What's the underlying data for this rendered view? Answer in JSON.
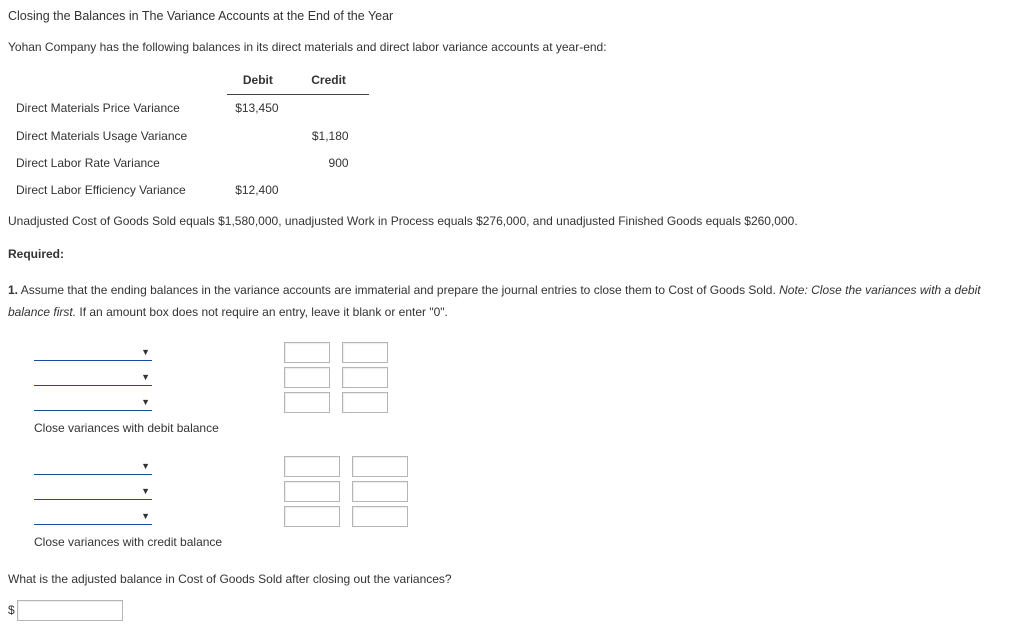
{
  "title": "Closing the Balances in The Variance Accounts at the End of the Year",
  "intro": "Yohan Company has the following balances in its direct materials and direct labor variance accounts at year-end:",
  "table": {
    "headers": {
      "debit": "Debit",
      "credit": "Credit"
    },
    "rows": [
      {
        "label": "Direct Materials Price Variance",
        "debit": "$13,450",
        "credit": ""
      },
      {
        "label": "Direct Materials Usage Variance",
        "debit": "",
        "credit": "$1,180"
      },
      {
        "label": "Direct Labor Rate Variance",
        "debit": "",
        "credit": "900"
      },
      {
        "label": "Direct Labor Efficiency Variance",
        "debit": "$12,400",
        "credit": ""
      }
    ]
  },
  "unadjusted_note": "Unadjusted Cost of Goods Sold equals $1,580,000, unadjusted Work in Process equals $276,000, and unadjusted Finished Goods equals $260,000.",
  "required_label": "Required:",
  "q1": {
    "num": "1.",
    "text_a": " Assume that the ending balances in the variance accounts are immaterial and prepare the journal entries to close them to Cost of Goods Sold. ",
    "note_label": "Note: ",
    "note_text": "Close the variances with a debit balance first.",
    "text_b": " If an amount box does not require an entry, leave it blank or enter \"0\"."
  },
  "entry_notes": {
    "debit": "Close variances with debit balance",
    "credit": "Close variances with credit balance"
  },
  "final_question": "What is the adjusted balance in Cost of Goods Sold after closing out the variances?",
  "dollar": "$"
}
